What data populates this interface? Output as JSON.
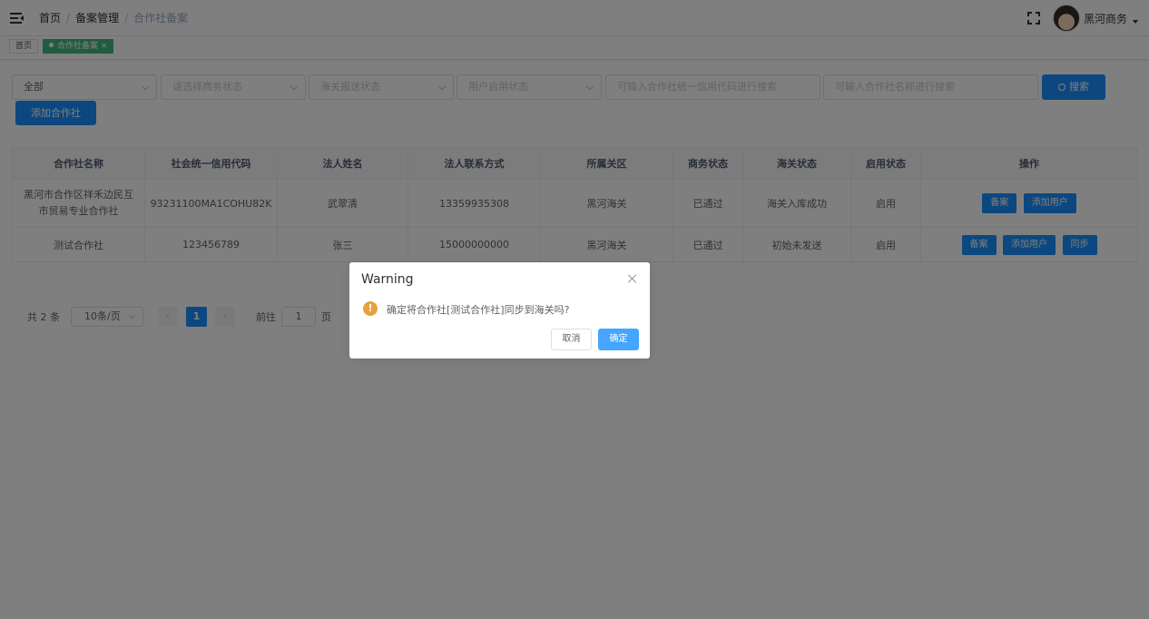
{
  "header": {
    "breadcrumb": [
      "首页",
      "备案管理",
      "合作社备案"
    ],
    "username": "黑河商务"
  },
  "tags": {
    "home": "首页",
    "active": "合作社备案"
  },
  "filters": {
    "scope_value": "全部",
    "business_status_placeholder": "请选择商务状态",
    "customs_status_placeholder": "海关报送状态",
    "user_status_placeholder": "用户启用状态",
    "credit_code_placeholder": "可输入合作社统一信用代码进行搜索",
    "name_placeholder": "可输入合作社名称进行搜索",
    "search_label": "搜索",
    "add_label": "添加合作社"
  },
  "table": {
    "columns": [
      "合作社名称",
      "社会统一信用代码",
      "法人姓名",
      "法人联系方式",
      "所属关区",
      "商务状态",
      "海关状态",
      "启用状态",
      "操作"
    ],
    "rows": [
      {
        "name": "黑河市合作区祥禾边民互市贸易专业合作社",
        "code": "93231100MA1COHU82K",
        "legal_name": "武翠清",
        "phone": "13359935308",
        "customs_area": "黑河海关",
        "business_status": "已通过",
        "customs_status": "海关入库成功",
        "enabled": "启用",
        "actions": [
          "备案",
          "添加用户"
        ]
      },
      {
        "name": "测试合作社",
        "code": "123456789",
        "legal_name": "张三",
        "phone": "15000000000",
        "customs_area": "黑河海关",
        "business_status": "已通过",
        "customs_status": "初始未发送",
        "enabled": "启用",
        "actions": [
          "备案",
          "添加用户",
          "同步"
        ]
      }
    ]
  },
  "pagination": {
    "total": "共 2 条",
    "page_size": "10条/页",
    "current_page": "1",
    "goto_label": "前往",
    "goto_value": "1",
    "page_suffix": "页"
  },
  "dialog": {
    "title": "Warning",
    "message": "确定将合作社[测试合作社]同步到海关吗?",
    "cancel_label": "取消",
    "confirm_label": "确定"
  },
  "colors": {
    "primary": "#1890ff",
    "warning": "#e6a23c",
    "tag_active": "#42b983"
  }
}
